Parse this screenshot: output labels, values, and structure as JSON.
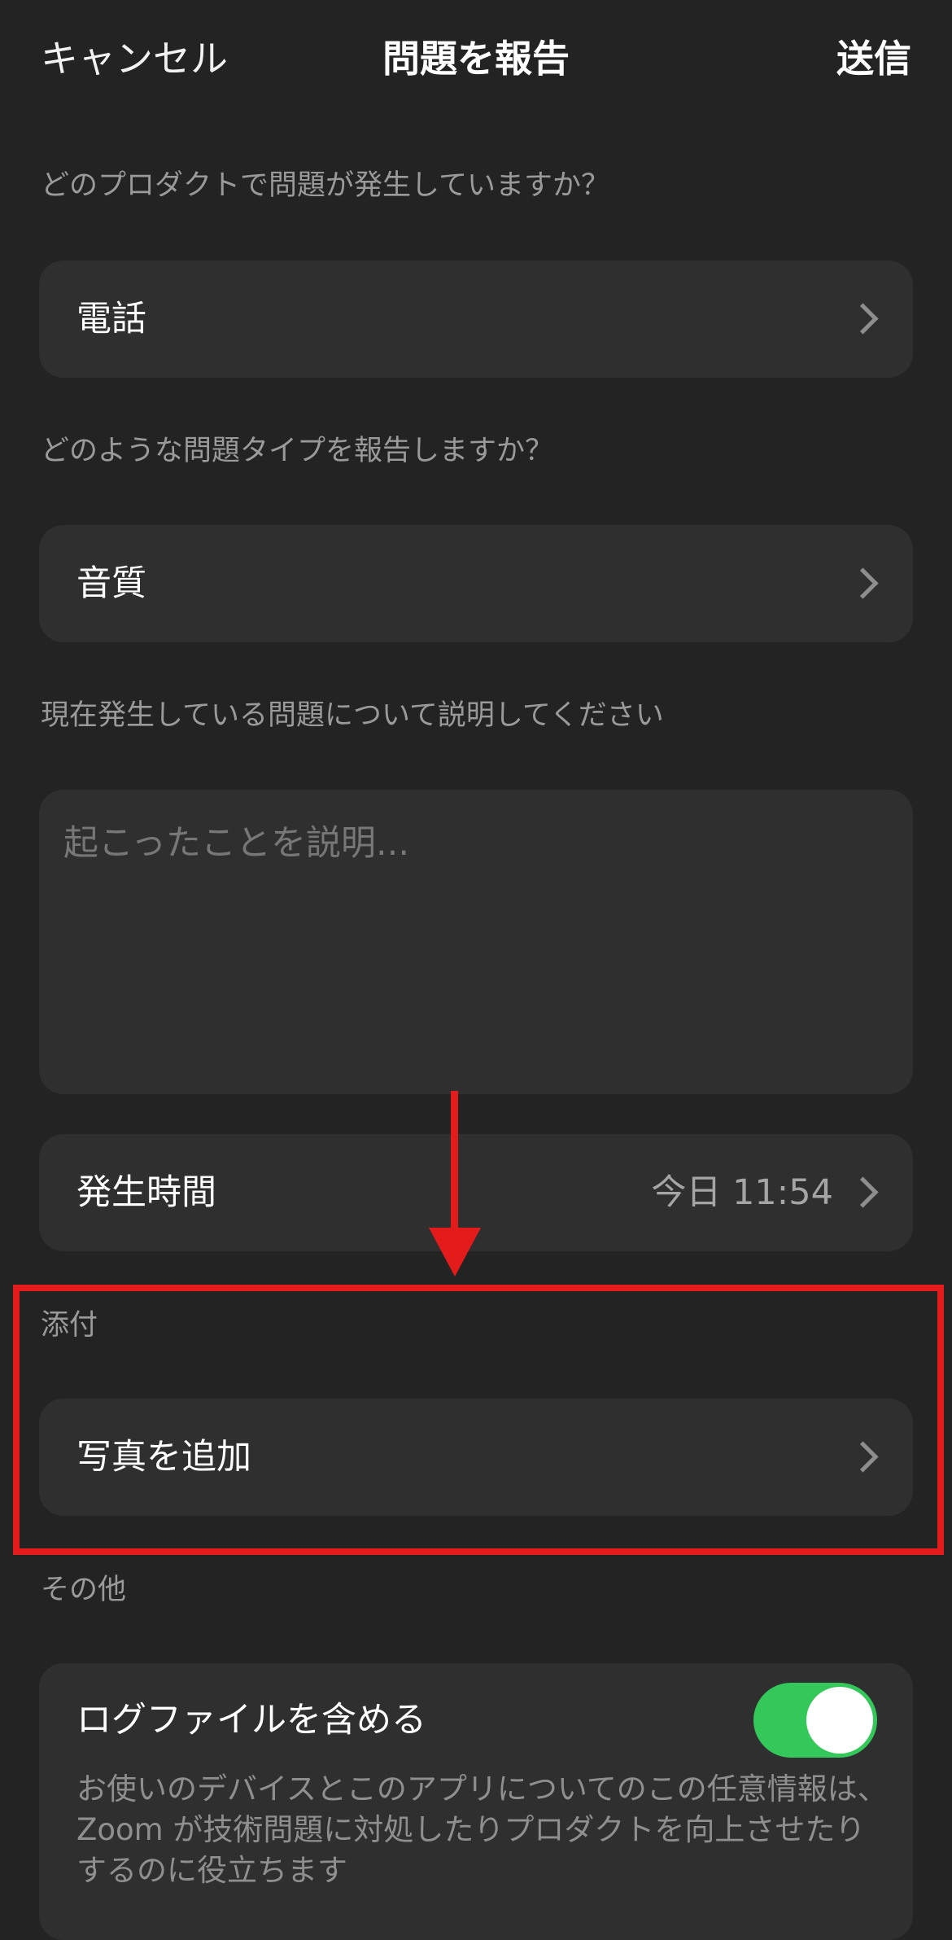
{
  "header": {
    "cancel_label": "キャンセル",
    "title": "問題を報告",
    "send_label": "送信"
  },
  "product_section": {
    "label": "どのプロダクトで問題が発生していますか？",
    "value": "電話"
  },
  "issue_type_section": {
    "label": "どのような問題タイプを報告しますか？",
    "value": "音質"
  },
  "description_section": {
    "label": "現在発生している問題について説明してください",
    "placeholder": "起こったことを説明..."
  },
  "occurrence_time": {
    "label": "発生時間",
    "value": "今日 11:54"
  },
  "attachment_section": {
    "label": "添付",
    "add_photo_label": "写真を追加"
  },
  "other_section": {
    "label": "その他",
    "include_logs_label": "ログファイルを含める",
    "include_logs_enabled": true,
    "include_logs_description": "お使いのデバイスとこのアプリについてのこの任意情報は、Zoom が技術問題に対処したりプロダクトを向上させたりするのに役立ちます"
  },
  "colors": {
    "background": "#232323",
    "card": "#2f2f2f",
    "toggle_on": "#34c759",
    "annotation": "#e31b1b"
  },
  "icons": {
    "row_chevron": "chevron-right-icon"
  }
}
